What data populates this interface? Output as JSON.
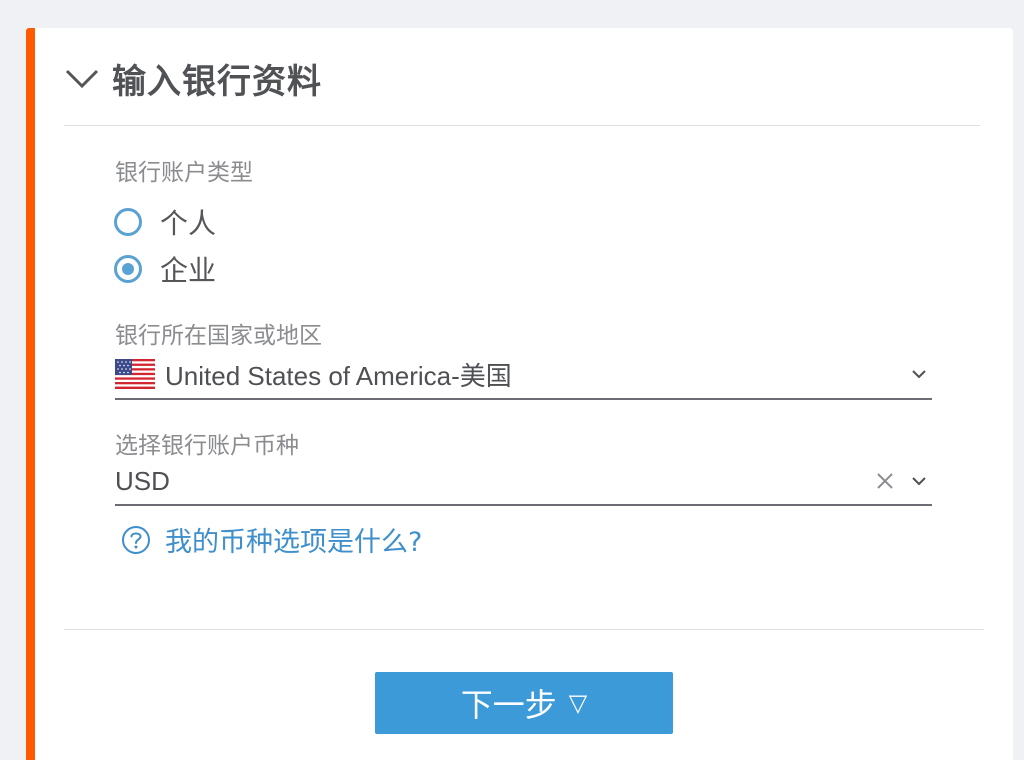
{
  "section": {
    "title": "输入银行资料",
    "collapse_icon": "chevron-down-icon"
  },
  "account_type": {
    "label": "银行账户类型",
    "options": [
      {
        "label": "个人",
        "selected": false
      },
      {
        "label": "企业",
        "selected": true
      }
    ]
  },
  "bank_country": {
    "label": "银行所在国家或地区",
    "value": "United States of America-美国",
    "flag_icon": "us-flag-icon"
  },
  "currency": {
    "label": "选择银行账户币种",
    "value": "USD"
  },
  "help_link": {
    "text": "我的币种选项是什么?"
  },
  "next_button": {
    "label": "下一步",
    "arrow": "▽"
  },
  "colors": {
    "accent_bar": "#ff5a00",
    "primary_button": "#3d9ad8",
    "link": "#3e8fcb",
    "radio": "#5aa2d3"
  }
}
